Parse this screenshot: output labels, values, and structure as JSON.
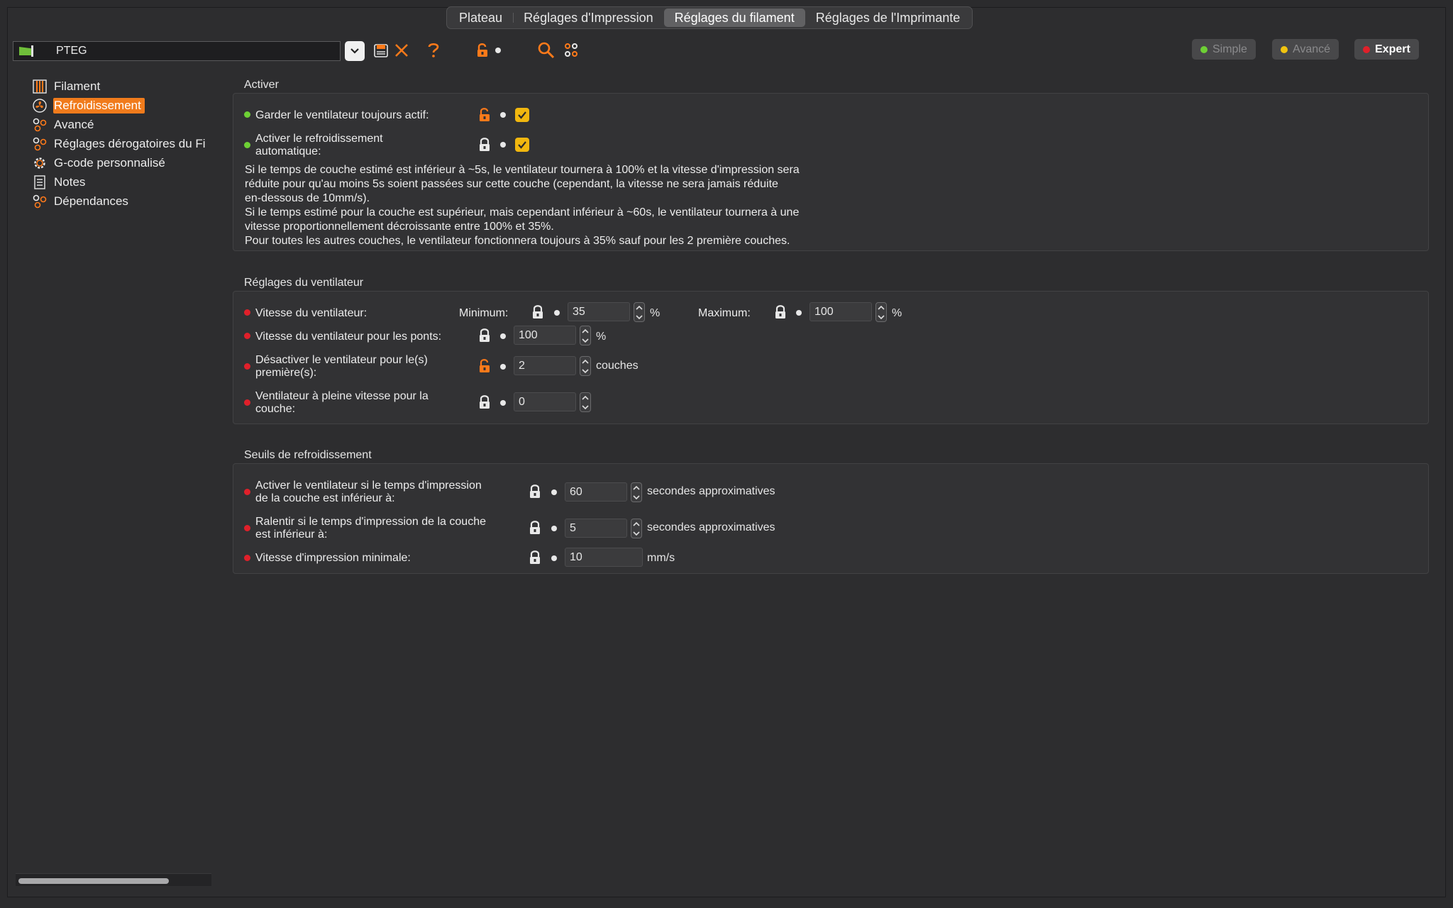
{
  "tabs": [
    {
      "label": "Plateau",
      "active": false
    },
    {
      "label": "Réglages d'Impression",
      "active": false
    },
    {
      "label": "Réglages du filament",
      "active": true
    },
    {
      "label": "Réglages de l'Imprimante",
      "active": false
    }
  ],
  "preset": {
    "name": "PTEG"
  },
  "modes": [
    {
      "label": "Simple",
      "color": "#6ed035"
    },
    {
      "label": "Avancé",
      "color": "#f1c40f"
    },
    {
      "label": "Expert",
      "color": "#e0202a"
    }
  ],
  "sidebar": {
    "items": [
      {
        "label": "Filament",
        "icon": "spool-icon"
      },
      {
        "label": "Refroidissement",
        "icon": "fan-icon"
      },
      {
        "label": "Avancé",
        "icon": "cogs-icon"
      },
      {
        "label": "Réglages dérogatoires du Fi",
        "icon": "cogs-icon"
      },
      {
        "label": "G-code personnalisé",
        "icon": "gear-icon"
      },
      {
        "label": "Notes",
        "icon": "notes-icon"
      },
      {
        "label": "Dépendances",
        "icon": "cogs-icon"
      }
    ]
  },
  "activer": {
    "title": "Activer",
    "keep_fan": {
      "label": "Garder le ventilateur toujours actif:",
      "checked": true
    },
    "auto_cool": {
      "label1": "Activer le refroidissement",
      "label2": "automatique:",
      "checked": true
    },
    "desc": [
      "Si le temps de couche estimé est inférieur à ~5s, le ventilateur tournera à 100% et la vitesse d'impression sera",
      "réduite pour qu'au moins 5s soient passées sur cette couche (cependant, la vitesse ne sera jamais réduite",
      "en-dessous de 10mm/s).",
      "Si le temps estimé pour la couche est supérieur, mais cependant inférieur à ~60s, le ventilateur tournera à une",
      "vitesse proportionnellement décroissante entre 100% et 35%.",
      "Pour toutes les autres couches, le ventilateur fonctionnera toujours à 35% sauf pour les 2 première couches."
    ]
  },
  "fan": {
    "title": "Réglages du ventilateur",
    "speed": {
      "label": "Vitesse du ventilateur:",
      "min_label": "Minimum:",
      "min": "35",
      "max_label": "Maximum:",
      "max": "100",
      "unit": "%"
    },
    "bridges": {
      "label": "Vitesse du ventilateur pour les ponts:",
      "value": "100",
      "unit": "%"
    },
    "disable_first": {
      "label1": "Désactiver le ventilateur pour le(s)",
      "label2": "première(s):",
      "value": "2",
      "unit": "couches"
    },
    "full_speed": {
      "label1": "Ventilateur à pleine vitesse pour la",
      "label2": "couche:",
      "value": "0"
    }
  },
  "seuils": {
    "title": "Seuils de refroidissement",
    "fan_below": {
      "label1": "Activer le ventilateur si le temps d'impression",
      "label2": "de la couche est inférieur à:",
      "value": "60",
      "unit": "secondes approximatives"
    },
    "slow_below": {
      "label1": "Ralentir si le temps d'impression de la couche",
      "label2": "est inférieur à:",
      "value": "5",
      "unit": "secondes approximatives"
    },
    "min_speed": {
      "label": "Vitesse d'impression minimale:",
      "value": "10",
      "unit": "mm/s"
    }
  }
}
